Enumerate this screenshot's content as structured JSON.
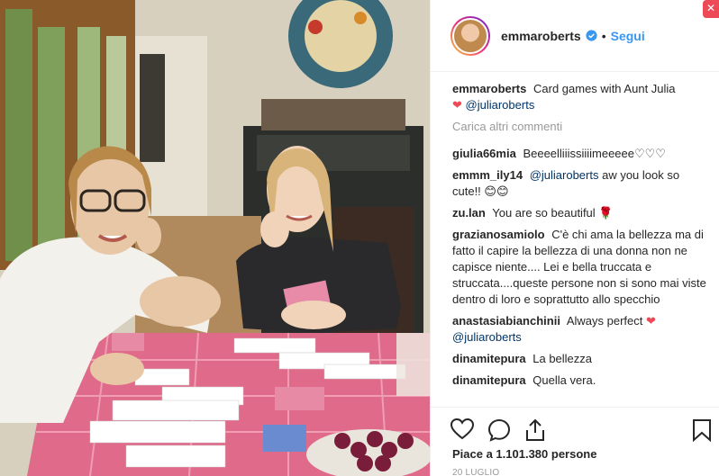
{
  "post": {
    "username": "emmaroberts",
    "follow_label": "Segui",
    "separator": "•",
    "caption_text": "Card games with Aunt Julia",
    "caption_mention": "@juliaroberts",
    "load_more_label": "Carica altri commenti",
    "likes_text": "Piace a 1.101.380 persone",
    "date_text": "20 LUGLIO"
  },
  "comments": [
    {
      "user": "giulia66mia",
      "text": "Beeeelliiissiiiimeeeee♡♡♡"
    },
    {
      "user": "emmm_ily14",
      "mention": "@juliaroberts",
      "text": "aw you look so cute!! 😊😊"
    },
    {
      "user": "zu.lan",
      "text": "You are so beautiful 🌹"
    },
    {
      "user": "grazianosamiolo",
      "text": "C'è chi ama la bellezza ma di fatto il capire la bellezza di una donna non ne capisce niente.... Lei e bella truccata e struccata....queste persone non si sono mai viste dentro di loro e soprattutto allo specchio"
    },
    {
      "user": "anastasiabianchinii",
      "text": "Always perfect",
      "mention_after": "@juliaroberts"
    },
    {
      "user": "dinamitepura",
      "text": "La bellezza"
    },
    {
      "user": "dinamitepura",
      "text": "Quella vera."
    }
  ],
  "colors": {
    "link_blue": "#3897f0",
    "mention_blue": "#003569",
    "heart_red": "#ed4956",
    "muted": "#999999"
  },
  "icons": [
    "verified-badge-icon",
    "heart-icon",
    "comment-icon",
    "share-icon",
    "bookmark-icon"
  ]
}
